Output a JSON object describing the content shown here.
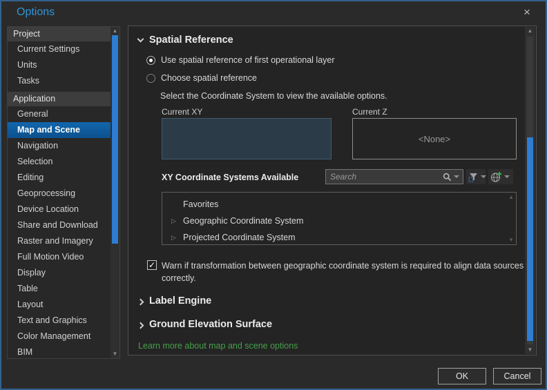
{
  "window": {
    "title": "Options",
    "close_glyph": "×"
  },
  "sidebar": {
    "groups": [
      {
        "header": "Project",
        "items": [
          {
            "label": "Current Settings"
          },
          {
            "label": "Units"
          },
          {
            "label": "Tasks"
          }
        ]
      },
      {
        "header": "Application",
        "items": [
          {
            "label": "General"
          },
          {
            "label": "Map and Scene",
            "selected": true
          },
          {
            "label": "Navigation"
          },
          {
            "label": "Selection"
          },
          {
            "label": "Editing"
          },
          {
            "label": "Geoprocessing"
          },
          {
            "label": "Device Location"
          },
          {
            "label": "Share and Download"
          },
          {
            "label": "Raster and Imagery"
          },
          {
            "label": "Full Motion Video"
          },
          {
            "label": "Display"
          },
          {
            "label": "Table"
          },
          {
            "label": "Layout"
          },
          {
            "label": "Text and Graphics"
          },
          {
            "label": "Color Management"
          },
          {
            "label": "BIM"
          }
        ]
      }
    ]
  },
  "main": {
    "spatial_reference": {
      "title": "Spatial Reference",
      "radio_use_first": {
        "label": "Use spatial reference of first operational layer",
        "checked": true
      },
      "radio_choose": {
        "label": "Choose spatial reference",
        "checked": false
      },
      "instruction": "Select the Coordinate System to view the available options.",
      "current_xy_label": "Current XY",
      "current_z_label": "Current Z",
      "current_z_value": "<None>",
      "available_label": "XY Coordinate Systems Available",
      "search": {
        "placeholder": "Search"
      },
      "tree": [
        {
          "label": "Favorites",
          "expandable": false
        },
        {
          "label": "Geographic Coordinate System",
          "expandable": true
        },
        {
          "label": "Projected Coordinate System",
          "expandable": true
        }
      ],
      "warn_checkbox": {
        "checked": true,
        "check_glyph": "✓",
        "label": "Warn if transformation between geographic coordinate system is required to align data sources correctly."
      }
    },
    "label_engine": {
      "title": "Label Engine"
    },
    "ground_elevation": {
      "title": "Ground Elevation Surface"
    },
    "learn_more": "Learn more about map and scene options"
  },
  "footer": {
    "ok": "OK",
    "cancel": "Cancel"
  },
  "icons": {
    "expander_glyph": "▷",
    "scroll_up_glyph": "▲",
    "scroll_down_glyph": "▼"
  },
  "colors": {
    "accent_scrollbar_blue": "#2d7dd2",
    "selection_blue": "#1266ad",
    "title_blue": "#3095d8",
    "link_green": "#46a04b",
    "current_xy_fill": "#2b3c48",
    "dialog_border_blue": "#33618d"
  }
}
